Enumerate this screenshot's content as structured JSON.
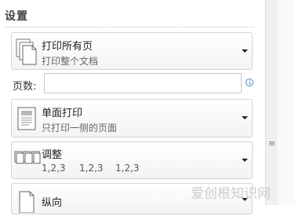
{
  "section": {
    "title": "设置"
  },
  "print_what": {
    "title": "打印所有页",
    "subtitle": "打印整个文档"
  },
  "pages": {
    "label": "页数:",
    "value": "",
    "placeholder": ""
  },
  "sides": {
    "title": "单面打印",
    "subtitle": "只打印一侧的页面"
  },
  "collation": {
    "title": "调整",
    "subtitle_items": [
      "1,2,3",
      "1,2,3",
      "1,2,3"
    ]
  },
  "orientation": {
    "title": "纵向"
  },
  "watermark": {
    "text": "爱创根知识网"
  },
  "colors": {
    "info_icon": "#4a86c8",
    "border": "#d4d4d4"
  }
}
